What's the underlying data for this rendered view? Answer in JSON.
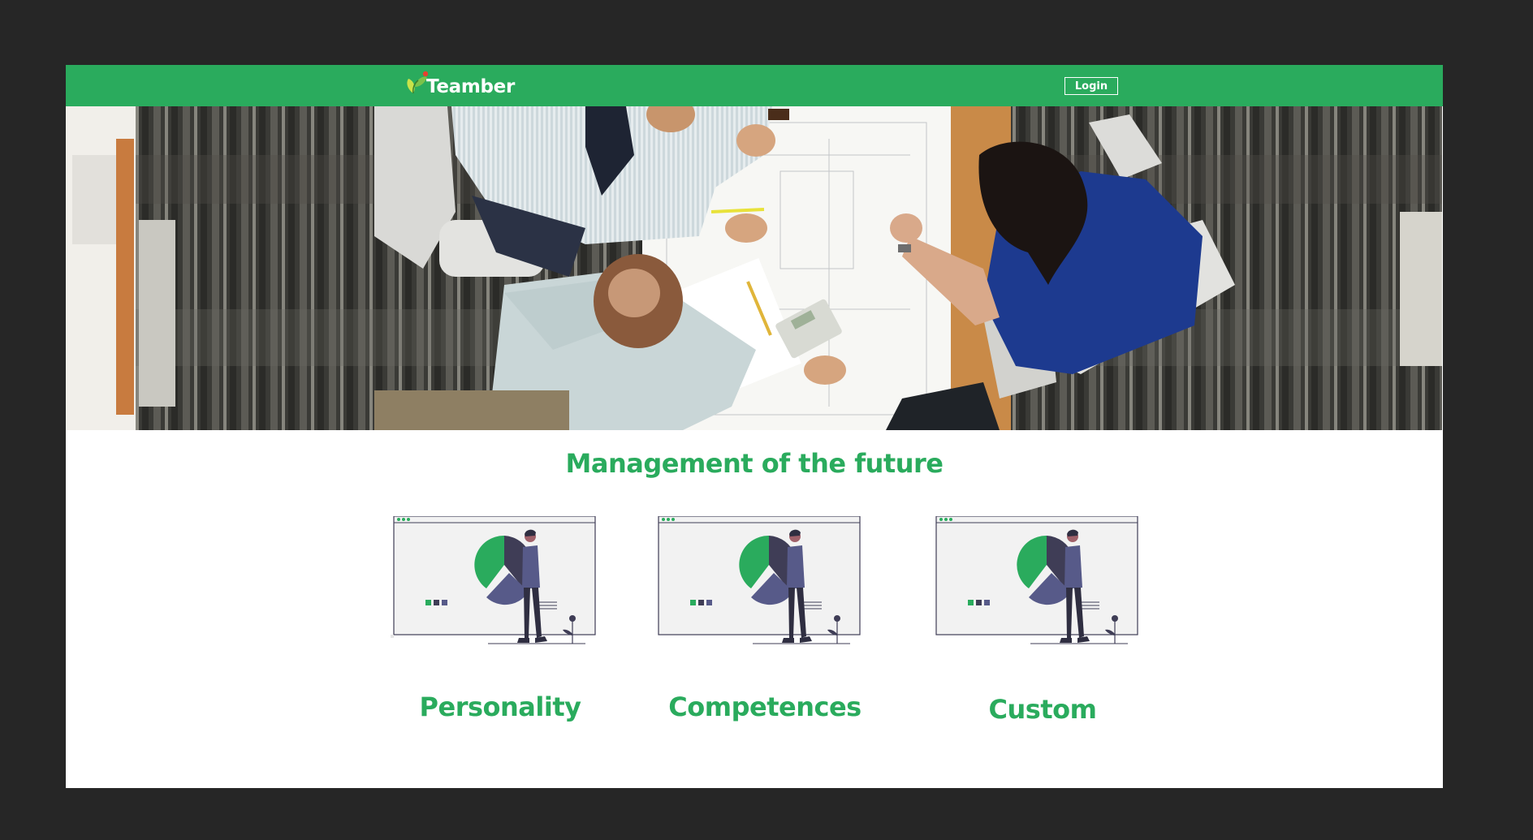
{
  "brand": {
    "name": "Teamber"
  },
  "nav": {
    "login_label": "Login"
  },
  "hero": {
    "image": "people-working-around-table-with-blueprints"
  },
  "main": {
    "headline": "Management of the future"
  },
  "cards": [
    {
      "label": "Personality",
      "icon": "pie-chart-presentation-illustration"
    },
    {
      "label": "Competences",
      "icon": "pie-chart-presentation-illustration"
    },
    {
      "label": "Custom",
      "icon": "pie-chart-presentation-illustration"
    }
  ],
  "colors": {
    "brand_green": "#2aab5d",
    "page_background": "#262626",
    "illustration_dark": "#3f3d56",
    "illustration_purple": "#575a89"
  }
}
